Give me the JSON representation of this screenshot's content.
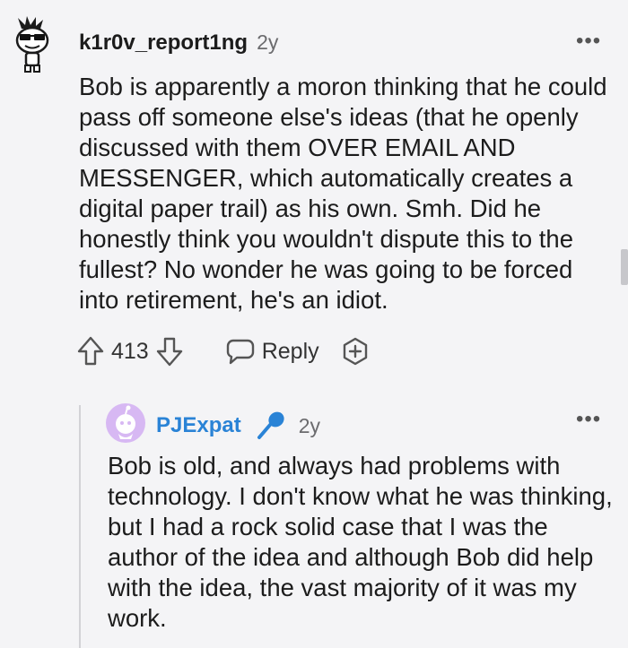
{
  "comment": {
    "username": "k1r0v_report1ng",
    "age": "2y",
    "more": "•••",
    "body": "Bob is apparently a moron thinking that he could pass off someone else's ideas (that he openly discussed with them OVER EMAIL AND MESSENGER, which automatically creates a digital paper trail) as his own. Smh. Did he honestly think you wouldn't dispute this to the fullest? No wonder he was going to be forced into retirement, he's an idiot.",
    "votes": "413",
    "reply_label": "Reply"
  },
  "reply": {
    "username": "PJExpat",
    "username_color": "#2a83d6",
    "age": "2y",
    "more": "•••",
    "body": "Bob is old, and always had problems with technology. I don't know what he was thinking, but I had a rock solid case that I was the author of the idea and although Bob did help with the idea, the vast majority of it was my work."
  },
  "icons": {
    "upvote": "arrow-up-icon",
    "downvote": "arrow-down-icon",
    "reply": "speech-bubble-icon",
    "award": "award-plus-icon",
    "op_badge": "microphone-icon"
  }
}
